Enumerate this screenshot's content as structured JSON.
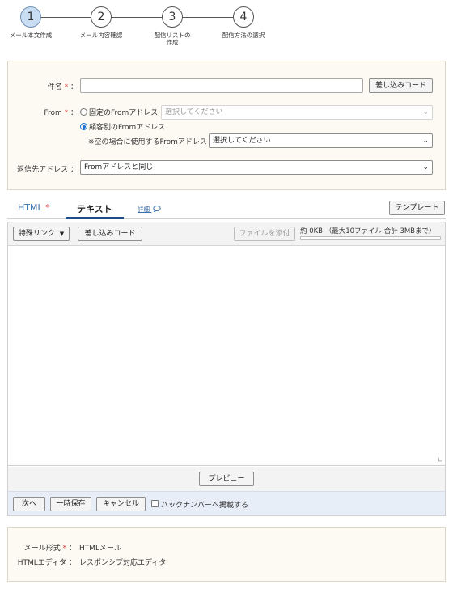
{
  "stepper": {
    "steps": [
      {
        "number": "1",
        "label_line1": "メール本文作成",
        "label_line2": ""
      },
      {
        "number": "2",
        "label_line1": "メール内容確認",
        "label_line2": ""
      },
      {
        "number": "3",
        "label_line1": "配信リストの",
        "label_line2": "作成"
      },
      {
        "number": "4",
        "label_line1": "配信方法の選択",
        "label_line2": ""
      }
    ],
    "active_step": 1
  },
  "form": {
    "subject_label": "件名",
    "required_mark": "*",
    "colon": "：",
    "insert_code_button": "差し込みコード",
    "from_label": "From",
    "from_option_fixed": "固定のFromアドレス",
    "from_select_placeholder": "選択してください",
    "from_option_customer": "顧客別のFromアドレス",
    "from_fallback_label": "※空の場合に使用するFromアドレス",
    "from_fallback_select": "選択してください",
    "reply_label": "返信先アドレス",
    "reply_select": "Fromアドレスと同じ",
    "subject_value": ""
  },
  "tabs": {
    "html_label": "HTML",
    "html_required": "*",
    "text_label": "テキスト",
    "detail_link": "詳細",
    "template_button": "テンプレート"
  },
  "editor": {
    "special_link_button": "特殊リンク",
    "insert_code_button": "差し込みコード",
    "attach_file_button": "ファイルを添付",
    "size_info": "約 0KB （最大10ファイル 合計 3MBまで）",
    "size_used_fraction": 0,
    "body_value": "",
    "preview_button": "プレビュー"
  },
  "actions": {
    "next_button": "次へ",
    "save_temp_button": "一時保存",
    "cancel_button": "キャンセル",
    "backnumber_checkbox_label": "バックナンバーへ掲載する"
  },
  "info": {
    "format_label": "メール形式",
    "format_required": "*",
    "format_value": "HTMLメール",
    "editor_label": "HTMLエディタ",
    "editor_value": "レスポンシブ対応エディタ",
    "colon": "："
  },
  "colors": {
    "accent": "#1e4f8c",
    "active_step": "#c9def3",
    "required": "#d9383a",
    "panel_bg": "#fcfaf3",
    "footer_bg": "#e7eef8"
  }
}
